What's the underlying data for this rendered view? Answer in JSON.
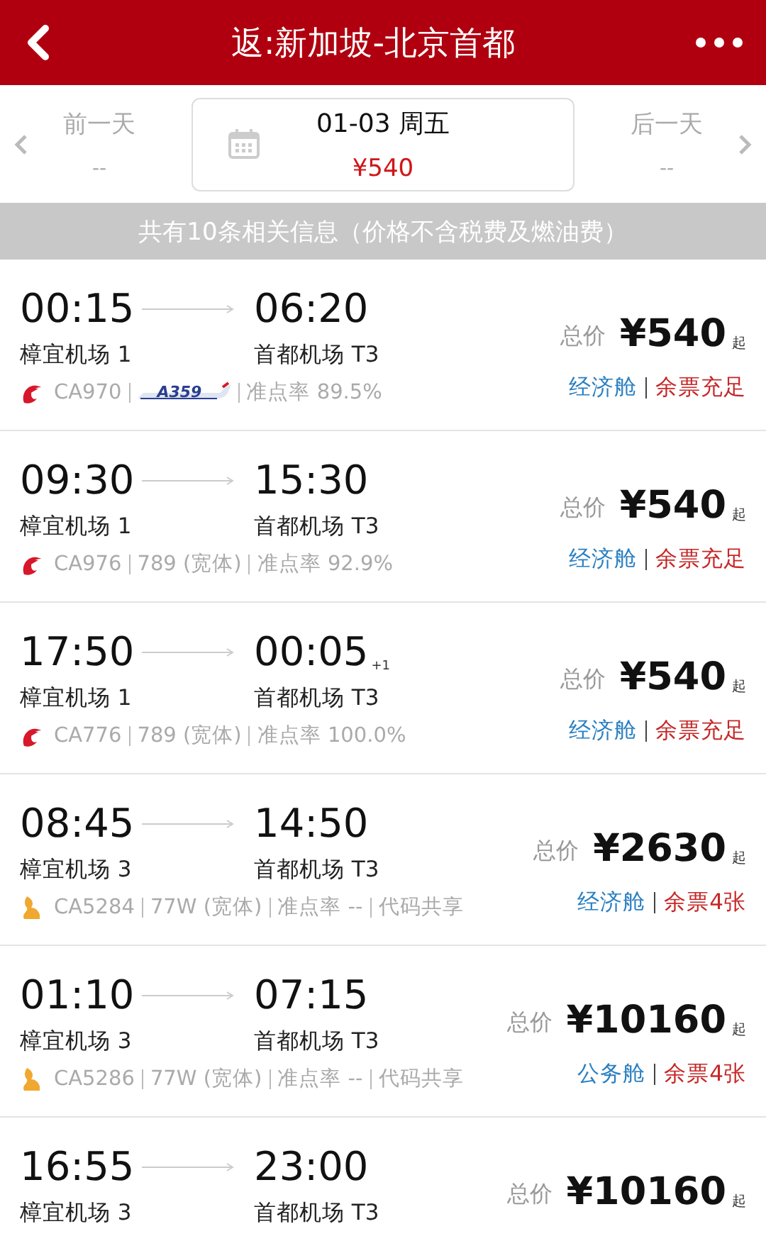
{
  "header": {
    "title": "返:新加坡-北京首都"
  },
  "date_bar": {
    "prev": {
      "label": "前一天",
      "price": "--"
    },
    "current": {
      "date": "01-03 周五",
      "price": "¥540"
    },
    "next": {
      "label": "后一天",
      "price": "--"
    }
  },
  "notice": "共有10条相关信息（价格不含税费及燃油费）",
  "flights": [
    {
      "depart": "00:15",
      "arrive": "06:20",
      "from": "樟宜机场 1",
      "to": "首都机场 T3",
      "logo": {
        "kind": "air_china"
      },
      "flight": "CA970",
      "aircraft": {
        "kind": "badge",
        "text": "A359"
      },
      "punctuality": "准点率 89.5%",
      "total_label": "总价",
      "price": "¥540",
      "price_suffix": "起",
      "cabin": "经济舱",
      "availability": "余票充足"
    },
    {
      "depart": "09:30",
      "arrive": "15:30",
      "from": "樟宜机场 1",
      "to": "首都机场 T3",
      "logo": {
        "kind": "air_china"
      },
      "flight": "CA976",
      "aircraft": {
        "kind": "text",
        "text": "789 (宽体)"
      },
      "punctuality": "准点率 92.9%",
      "total_label": "总价",
      "price": "¥540",
      "price_suffix": "起",
      "cabin": "经济舱",
      "availability": "余票充足"
    },
    {
      "depart": "17:50",
      "arrive": "00:05",
      "arrive_day": "+1",
      "from": "樟宜机场 1",
      "to": "首都机场 T3",
      "logo": {
        "kind": "air_china"
      },
      "flight": "CA776",
      "aircraft": {
        "kind": "text",
        "text": "789 (宽体)"
      },
      "punctuality": "准点率 100.0%",
      "total_label": "总价",
      "price": "¥540",
      "price_suffix": "起",
      "cabin": "经济舱",
      "availability": "余票充足"
    },
    {
      "depart": "08:45",
      "arrive": "14:50",
      "from": "樟宜机场 3",
      "to": "首都机场 T3",
      "logo": {
        "kind": "singapore"
      },
      "flight": "CA5284",
      "aircraft": {
        "kind": "text",
        "text": "77W (宽体)"
      },
      "punctuality": "准点率 --",
      "codeshare": "代码共享",
      "total_label": "总价",
      "price": "¥2630",
      "price_suffix": "起",
      "cabin": "经济舱",
      "availability": "余票4张"
    },
    {
      "depart": "01:10",
      "arrive": "07:15",
      "from": "樟宜机场 3",
      "to": "首都机场 T3",
      "logo": {
        "kind": "singapore"
      },
      "flight": "CA5286",
      "aircraft": {
        "kind": "text",
        "text": "77W (宽体)"
      },
      "punctuality": "准点率 --",
      "codeshare": "代码共享",
      "total_label": "总价",
      "price": "¥10160",
      "price_suffix": "起",
      "cabin": "公务舱",
      "availability": "余票4张"
    },
    {
      "depart": "16:55",
      "arrive": "23:00",
      "from": "樟宜机场 3",
      "to": "首都机场 T3",
      "total_label": "总价",
      "price": "¥10160",
      "price_suffix": "起"
    }
  ]
}
